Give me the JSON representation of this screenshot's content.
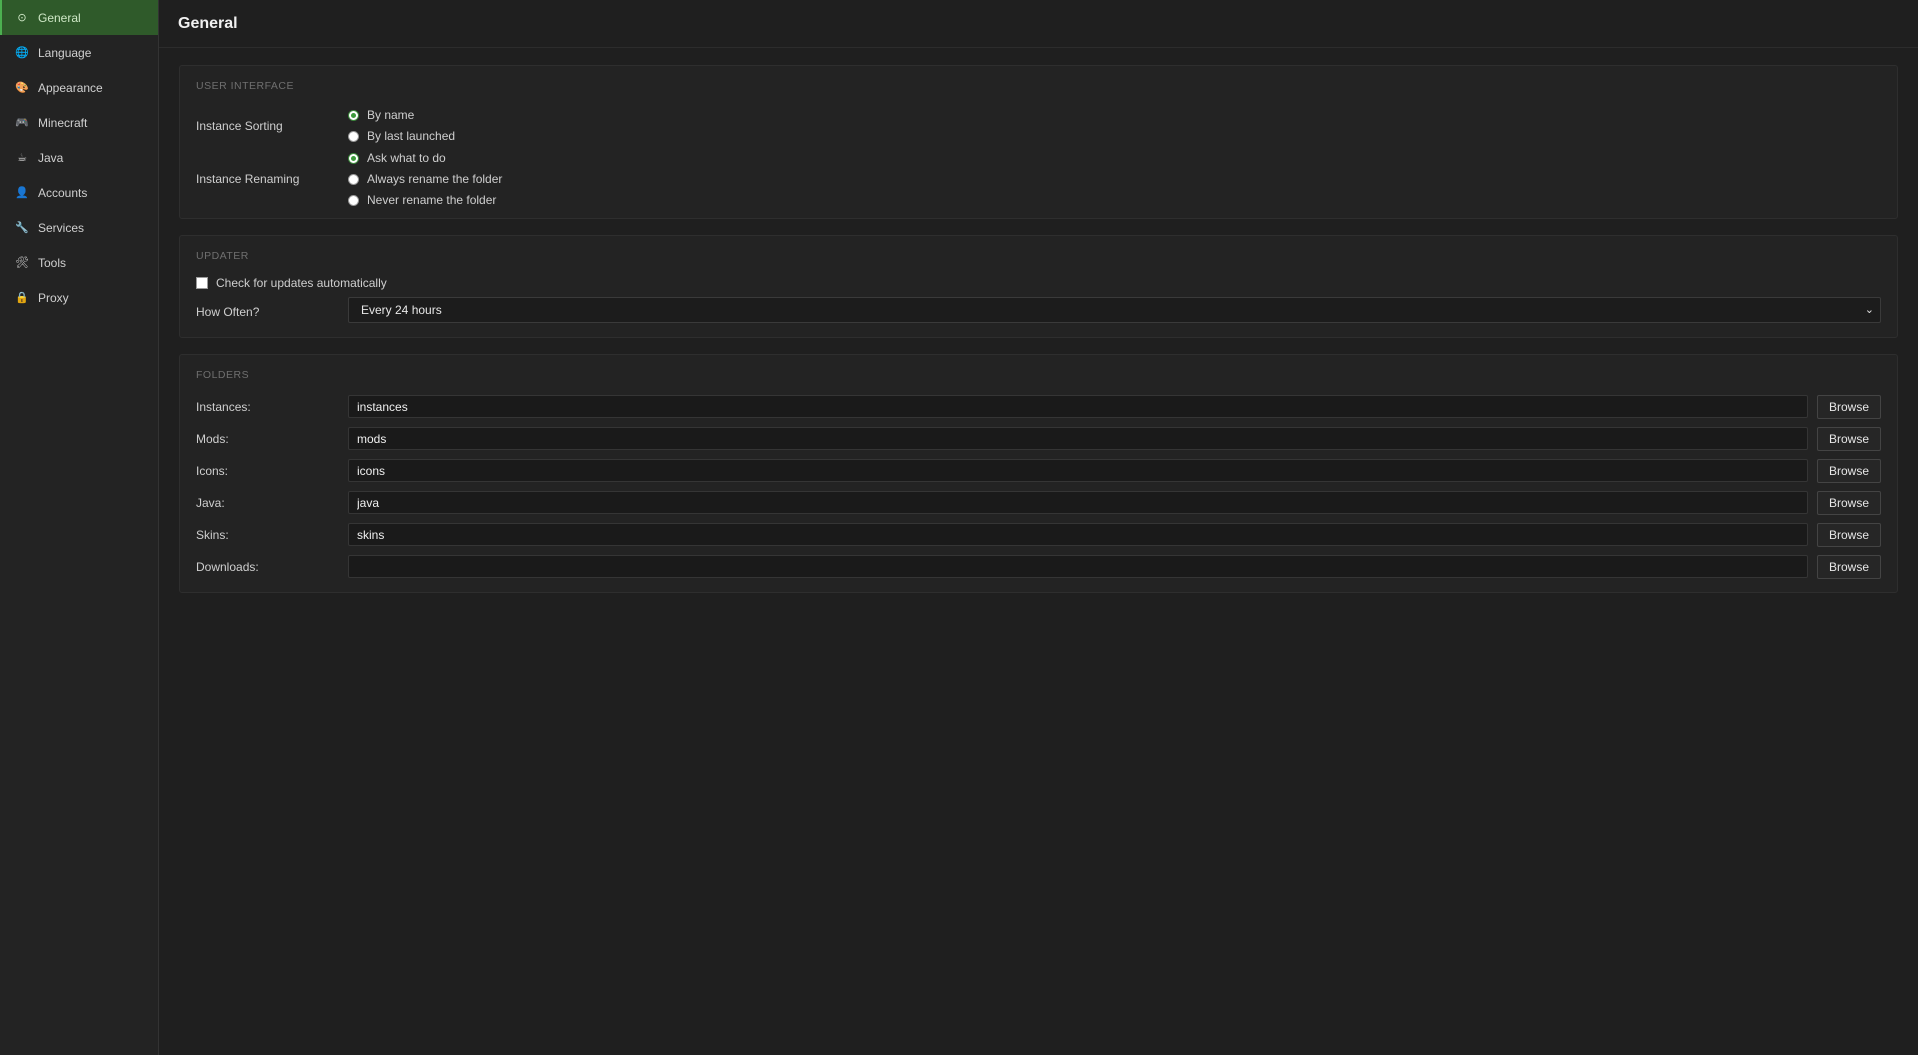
{
  "sidebar": {
    "items": [
      {
        "label": "General",
        "icon": "gear-icon",
        "icon_glyph": "⊙",
        "icon_color": "#cfe8c6",
        "active": true
      },
      {
        "label": "Language",
        "icon": "globe-icon",
        "icon_glyph": "🌐",
        "icon_color": "#5aa0e0",
        "active": false
      },
      {
        "label": "Appearance",
        "icon": "palette-icon",
        "icon_glyph": "🎨",
        "icon_color": "#e07a5f",
        "active": false
      },
      {
        "label": "Minecraft",
        "icon": "gamepad-icon",
        "icon_glyph": "🎮",
        "icon_color": "#8a6fd0",
        "active": false
      },
      {
        "label": "Java",
        "icon": "coffee-icon",
        "icon_glyph": "☕",
        "icon_color": "#c9a27a",
        "active": false
      },
      {
        "label": "Accounts",
        "icon": "user-icon",
        "icon_glyph": "👤",
        "icon_color": "#7b3fa0",
        "active": false
      },
      {
        "label": "Services",
        "icon": "wrench-icon",
        "icon_glyph": "🔧",
        "icon_color": "#b0b0b0",
        "active": false
      },
      {
        "label": "Tools",
        "icon": "tools-icon",
        "icon_glyph": "🛠",
        "icon_color": "#b0b0b0",
        "active": false
      },
      {
        "label": "Proxy",
        "icon": "lock-icon",
        "icon_glyph": "🔒",
        "icon_color": "#e5b32c",
        "active": false
      }
    ]
  },
  "page": {
    "title": "General"
  },
  "user_interface": {
    "title": "USER INTERFACE",
    "sorting_label": "Instance Sorting",
    "sorting_options": [
      {
        "label": "By name",
        "checked": true
      },
      {
        "label": "By last launched",
        "checked": false
      }
    ],
    "renaming_label": "Instance Renaming",
    "renaming_options": [
      {
        "label": "Ask what to do",
        "checked": true
      },
      {
        "label": "Always rename the folder",
        "checked": false
      },
      {
        "label": "Never rename the folder",
        "checked": false
      }
    ]
  },
  "updater": {
    "title": "UPDATER",
    "auto_check_label": "Check for updates automatically",
    "auto_check": false,
    "how_often_label": "How Often?",
    "how_often_value": "Every 24 hours"
  },
  "folders": {
    "title": "FOLDERS",
    "browse_label": "Browse",
    "rows": [
      {
        "label": "Instances:",
        "value": "instances"
      },
      {
        "label": "Mods:",
        "value": "mods"
      },
      {
        "label": "Icons:",
        "value": "icons"
      },
      {
        "label": "Java:",
        "value": "java"
      },
      {
        "label": "Skins:",
        "value": "skins"
      },
      {
        "label": "Downloads:",
        "value": ""
      }
    ]
  },
  "colors": {
    "accent": "#4caf50",
    "active_nav_bg": "#2f5a2a",
    "background": "#1f1f1f"
  }
}
